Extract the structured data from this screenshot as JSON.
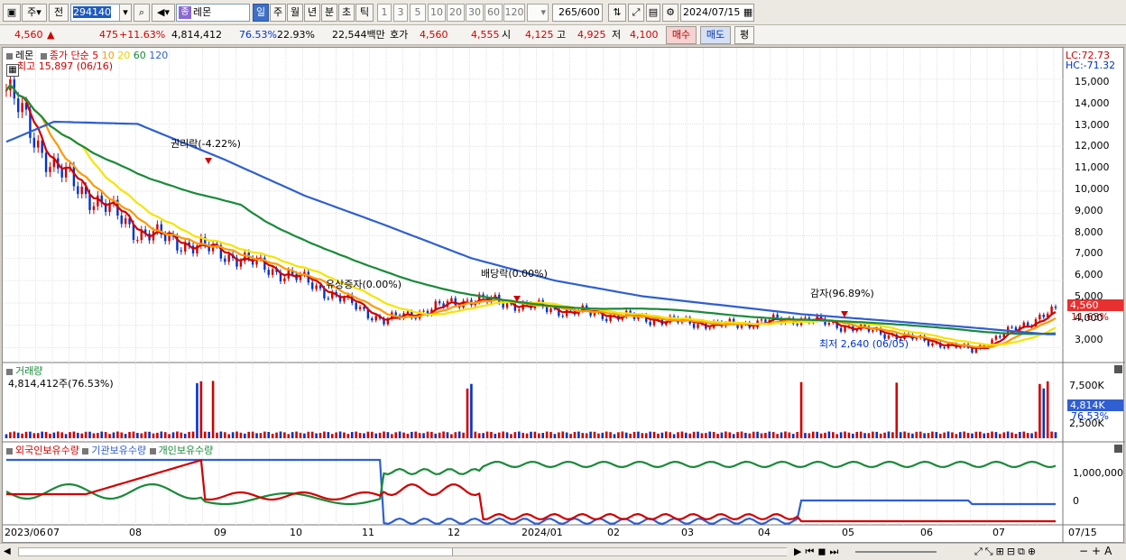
{
  "toolbar": {
    "period_label": "주",
    "type_label": "전",
    "stock_code": "294140",
    "stock_name": "레몬",
    "name_badge": "종",
    "timeframes": [
      "일",
      "주",
      "월",
      "년",
      "분",
      "초",
      "틱"
    ],
    "active_timeframe": "일",
    "intervals": [
      "1",
      "3",
      "5",
      "10",
      "20",
      "30",
      "60",
      "120"
    ],
    "count": "265",
    "count_max": "/600",
    "date": "2024/07/15"
  },
  "quote": {
    "price": "4,560",
    "change": "475",
    "change_pct": "+11.63%",
    "volume": "4,814,412",
    "vol_ratio": "76.53%",
    "turnover": "22.93%",
    "amount": "22,544백만",
    "hoga_label": "호가",
    "hoga1": "4,560",
    "hoga2": "4,555",
    "open_label": "시",
    "open": "4,125",
    "high_label": "고",
    "high": "4,925",
    "low_label": "저",
    "low": "4,100",
    "buy_label": "매수",
    "sell_label": "매도",
    "avg_label": "평"
  },
  "price_panel": {
    "title": "레몬",
    "ma_label": "종가 단순",
    "ma_periods": [
      "5",
      "10",
      "20",
      "60",
      "120"
    ],
    "ma_colors": [
      "#d20000",
      "#ff9900",
      "#f5e400",
      "#1a8a3a",
      "#2f5fd0"
    ],
    "lc": "LC:72.73",
    "hc": "HC:-71.32",
    "high_note": "최고 15,897 (06/16)",
    "low_note": "최저 2,640 (06/05)",
    "events": [
      {
        "label": "권리락(-4.22%)"
      },
      {
        "label": "배당락(0.00%)"
      },
      {
        "label": "유상증자(0.00%)"
      },
      {
        "label": "감자(96.89%)"
      }
    ],
    "y_ticks": [
      "15,000",
      "14,000",
      "13,000",
      "12,000",
      "11,000",
      "10,000",
      "9,000",
      "8,000",
      "7,000",
      "6,000",
      "5,000",
      "4,000",
      "3,000"
    ],
    "current_price": "4,560",
    "current_pct": "11.63%"
  },
  "volume_panel": {
    "title": "거래량",
    "value": "4,814,412주(76.53%)",
    "y_ticks": [
      "7,500K",
      "5,000K",
      "2,500K"
    ],
    "current": "4,814K",
    "current_pct": "76.53%"
  },
  "holding_panel": {
    "series": [
      {
        "name": "외국인보유수량",
        "color": "#d20000"
      },
      {
        "name": "기관보유수량",
        "color": "#2f5fd0"
      },
      {
        "name": "개인보유수량",
        "color": "#1a8a3a"
      }
    ],
    "y_ticks": [
      "1,000,000",
      "0"
    ]
  },
  "x_axis": [
    "2023/06",
    "07",
    "08",
    "09",
    "10",
    "11",
    "12",
    "2024/01",
    "02",
    "03",
    "04",
    "05",
    "06",
    "07",
    "07/15"
  ],
  "chart_data": {
    "type": "candlestick",
    "x": [
      "2023/06",
      "07",
      "08",
      "09",
      "10",
      "11",
      "12",
      "2024/01",
      "02",
      "03",
      "04",
      "05",
      "06",
      "07"
    ],
    "ylim": [
      2500,
      16000
    ],
    "close_approx": [
      14500,
      11000,
      8200,
      7200,
      6000,
      4200,
      5200,
      4700,
      4300,
      4000,
      4300,
      3600,
      2900,
      4560
    ],
    "ma120_approx": [
      12200,
      13100,
      13000,
      11400,
      9800,
      8500,
      7000,
      6000,
      5300,
      4900,
      4500,
      4200,
      3900,
      3600
    ]
  }
}
